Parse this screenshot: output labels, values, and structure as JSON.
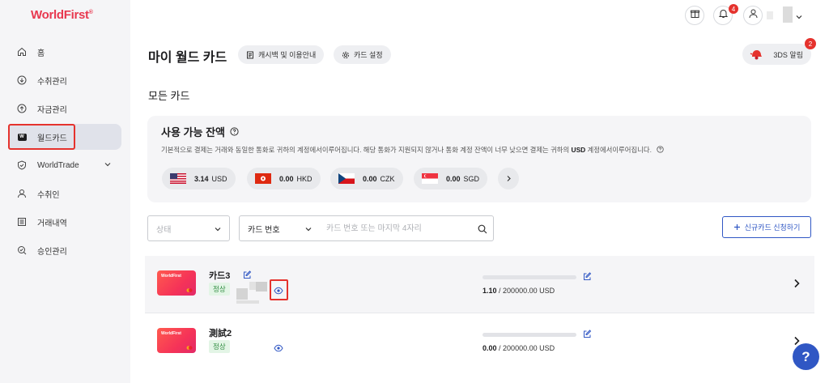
{
  "brand": {
    "logo": "WorldFirst",
    "accent": "#e8384f"
  },
  "sidebar": {
    "items": [
      {
        "label": "홈",
        "icon": "home-icon"
      },
      {
        "label": "수취관리",
        "icon": "receive-icon"
      },
      {
        "label": "자금관리",
        "icon": "funds-icon"
      },
      {
        "label": "월드카드",
        "icon": "world-card-icon",
        "active": true
      },
      {
        "label": "WorldTrade",
        "icon": "shield-icon"
      },
      {
        "label": "수취인",
        "icon": "user-icon"
      },
      {
        "label": "거래내역",
        "icon": "list-icon"
      },
      {
        "label": "승인관리",
        "icon": "approval-icon"
      }
    ]
  },
  "topbar": {
    "notification_count": "4"
  },
  "header": {
    "title": "마이 월드 카드",
    "cashback_label": "캐시백 및 이용안내",
    "settings_label": "카드 설정",
    "tds_label": "3DS 알림",
    "tds_count": "2"
  },
  "section_title": "모든 카드",
  "balance": {
    "title": "사용 가능 잔액",
    "desc_prefix": "기본적으로 결제는 거래와 동일한 통화로 귀하의 계정에서이루어집니다. 해당 통화가 지원되지 않거나 통화 계정 잔액이 너무 낮으면 결제는 귀하의 ",
    "desc_currency": "USD",
    "desc_suffix": " 계정에서이루어집니다.",
    "currencies": [
      {
        "amount": "3.14",
        "code": "USD",
        "flag": "us-flag"
      },
      {
        "amount": "0.00",
        "code": "HKD",
        "flag": "hk-flag"
      },
      {
        "amount": "0.00",
        "code": "CZK",
        "flag": "cz-flag"
      },
      {
        "amount": "0.00",
        "code": "SGD",
        "flag": "sg-flag"
      }
    ]
  },
  "filters": {
    "status_placeholder": "상태",
    "field_select": "카드 번호",
    "search_placeholder": "카드 번호 또는 마지막 4자리",
    "new_card_label": "신규카드 신청하기"
  },
  "cards": [
    {
      "name": "카드3",
      "status": "정상",
      "used": "1.10",
      "limit": "/ 200000.00 USD",
      "usage_fraction": 5.5e-06
    },
    {
      "name": "測試2",
      "status": "정상",
      "used": "0.00",
      "limit": "/ 200000.00 USD",
      "usage_fraction": 0
    }
  ],
  "card_thumb_label": "WorldFirst",
  "help_label": "?"
}
